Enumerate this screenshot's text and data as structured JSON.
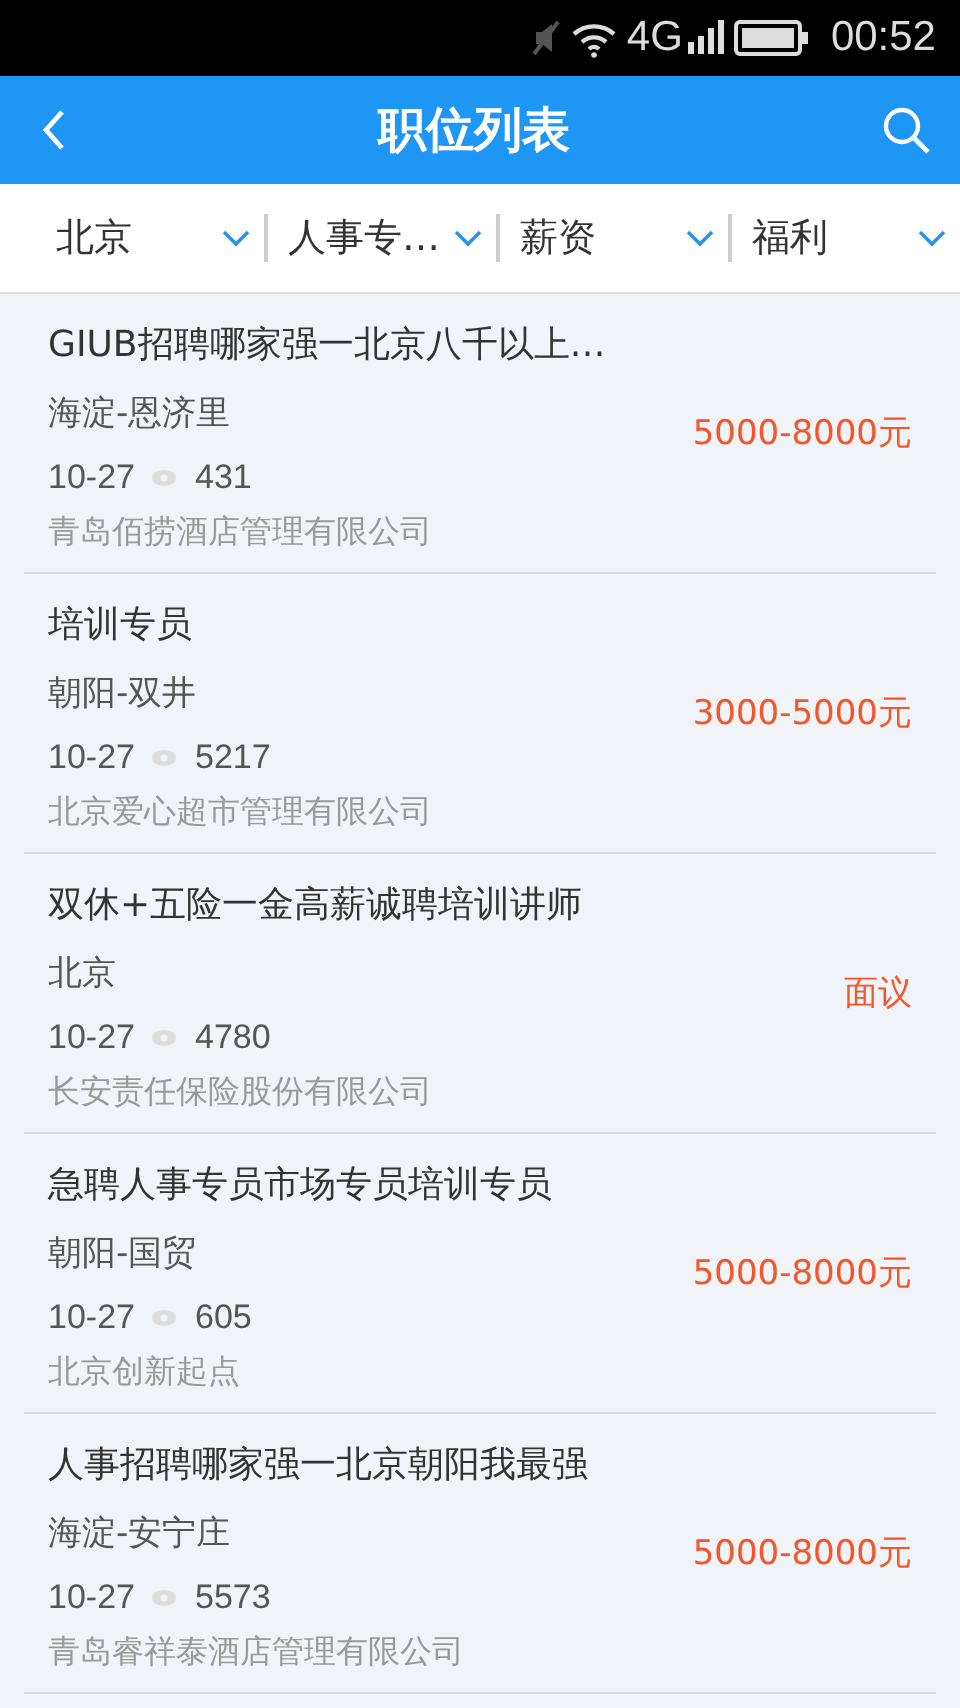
{
  "status_bar": {
    "network": "4G",
    "time": "00:52"
  },
  "header": {
    "title": "职位列表"
  },
  "filters": [
    {
      "label": "北京"
    },
    {
      "label": "人事专…"
    },
    {
      "label": "薪资"
    },
    {
      "label": "福利"
    }
  ],
  "jobs": [
    {
      "title": "GIUB招聘哪家强一北京八千以上…",
      "location": "海淀-恩济里",
      "date": "10-27",
      "views": "431",
      "company": "青岛佰捞酒店管理有限公司",
      "salary": "5000-8000元"
    },
    {
      "title": "培训专员",
      "location": "朝阳-双井",
      "date": "10-27",
      "views": "5217",
      "company": "北京爱心超市管理有限公司",
      "salary": "3000-5000元"
    },
    {
      "title": "双休+五险一金高薪诚聘培训讲师",
      "location": "北京",
      "date": "10-27",
      "views": "4780",
      "company": "长安责任保险股份有限公司",
      "salary": "面议"
    },
    {
      "title": "急聘人事专员市场专员培训专员",
      "location": "朝阳-国贸",
      "date": "10-27",
      "views": "605",
      "company": "北京创新起点",
      "salary": "5000-8000元"
    },
    {
      "title": "人事招聘哪家强一北京朝阳我最强",
      "location": "海淀-安宁庄",
      "date": "10-27",
      "views": "5573",
      "company": "青岛睿祥泰酒店管理有限公司",
      "salary": "5000-8000元"
    }
  ]
}
